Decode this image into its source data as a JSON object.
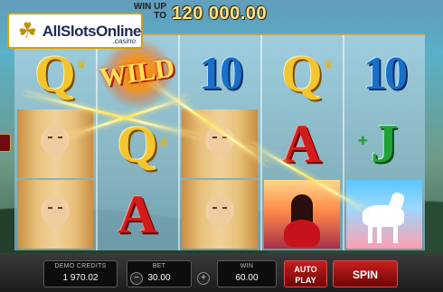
{
  "header": {
    "logo_text": "AllSlotsOnline",
    "logo_sub": ".casino",
    "logo_icon": "clover-icon",
    "win_upto": "WIN UP TO",
    "win_amount": "120 000.00"
  },
  "reels": [
    [
      "Q",
      "portrait",
      "portrait"
    ],
    [
      "WILD",
      "Q",
      "A"
    ],
    [
      "10",
      "portrait",
      "portrait"
    ],
    [
      "Q",
      "A",
      "couple"
    ],
    [
      "10",
      "J",
      "horse"
    ]
  ],
  "bottom": {
    "credits_label": "DEMO CREDITS",
    "credits_value": "1 970.02",
    "bet_label": "BET",
    "bet_value": "30.00",
    "win_label": "WIN",
    "win_value": "60.00",
    "autoplay_label": "AUTO PLAY",
    "spin_label": "SPIN",
    "minus_label": "−",
    "plus_label": "+"
  },
  "colors": {
    "accent": "#c81e1e",
    "win_amount": "#ffe58a",
    "frame": "#c7a25a"
  }
}
